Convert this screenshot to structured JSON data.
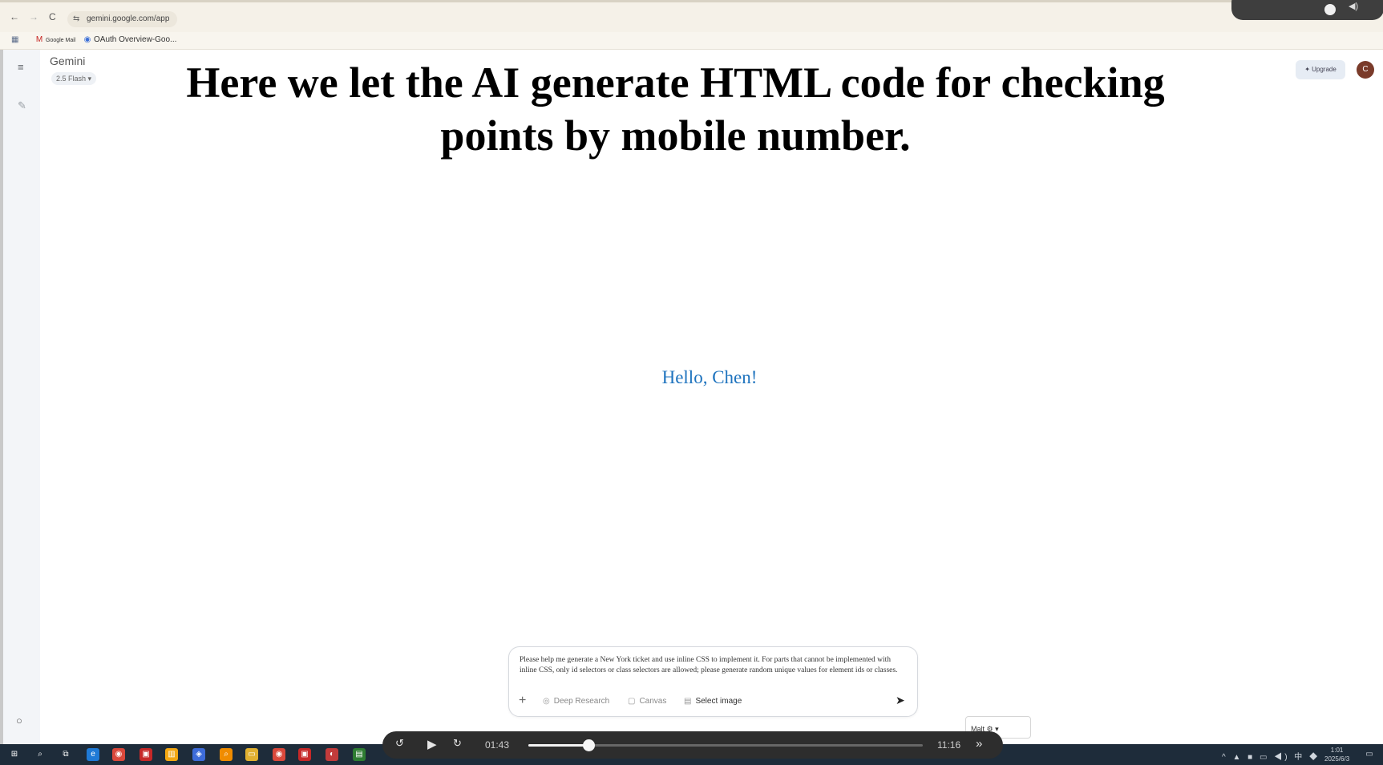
{
  "browser": {
    "url": "gemini.google.com/app",
    "back_icon": "←",
    "forward_icon": "→",
    "reload_icon": "C",
    "bookmarks": [
      {
        "icon": "M",
        "label": "Google Mail"
      },
      {
        "icon": "◉",
        "label": "OAuth Overview-Goo..."
      }
    ]
  },
  "gemini": {
    "brand": "Gemini",
    "model": "2.5 Flash ▾",
    "upgrade_label": "Upgrade",
    "avatar_initial": "C",
    "greeting": "Hello, Chen!"
  },
  "caption": {
    "line1": "Here we let the AI generate HTML code for checking",
    "line2": "points by mobile number."
  },
  "prompt": {
    "text": "Please help me generate a New York ticket and use inline CSS to implement it. For parts that cannot be implemented with inline CSS, only id selectors or class selectors are allowed; please generate random unique values for element ids or classes.",
    "tools": [
      "Deep Research",
      "Canvas",
      "Select image"
    ],
    "language_chip": "Malt"
  },
  "player": {
    "current_time": "01:43",
    "total_time": "11:16",
    "progress_fraction": 0.153
  },
  "taskbar": {
    "clock_time": "1:01",
    "clock_date": "2025/6/3"
  },
  "colors": {
    "greeting": "#1e73be",
    "taskbar": "#1e2c3a",
    "player": "#2d2d2d"
  }
}
